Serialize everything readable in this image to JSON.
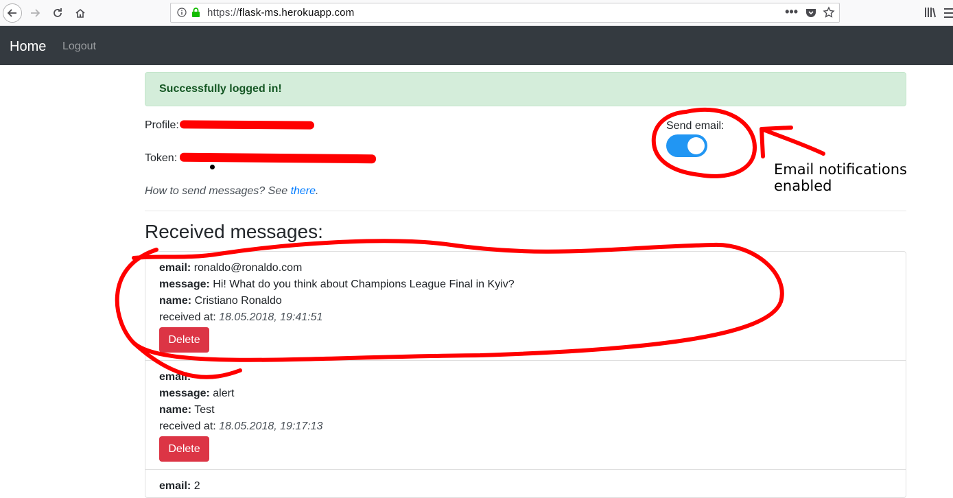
{
  "browser": {
    "url_scheme": "https://",
    "url_domain": "flask-ms.herokuapp.com",
    "dots": "•••"
  },
  "navbar": {
    "home_label": "Home",
    "logout_label": "Logout"
  },
  "alert": {
    "text": "Successfully logged in!",
    "color": "#155724",
    "background": "#d4edda"
  },
  "profile": {
    "profile_label": "Profile:",
    "token_label": "Token:",
    "howto_text": "How to send messages? See ",
    "howto_link": "there",
    "howto_end": "."
  },
  "settings": {
    "send_email_label": "Send email:",
    "send_email_enabled": true,
    "toggle_color": "#2196f3"
  },
  "annotation": {
    "line1": "Email notifications",
    "line2": "enabled",
    "color": "#ff0000"
  },
  "messages": {
    "heading": "Received messages:",
    "field_email": "email:",
    "field_message": "message:",
    "field_name": "name:",
    "field_received": "received at:",
    "delete_label": "Delete",
    "delete_color": "#dc3545",
    "items": [
      {
        "email": "ronaldo@ronaldo.com",
        "message": "Hi! What do you think about Champions League Final in Kyiv?",
        "name": "Cristiano Ronaldo",
        "received_at": "18.05.2018, 19:41:51"
      },
      {
        "email": "",
        "message": "alert",
        "name": "Test",
        "received_at": "18.05.2018, 19:17:13"
      },
      {
        "email": "2"
      }
    ]
  }
}
